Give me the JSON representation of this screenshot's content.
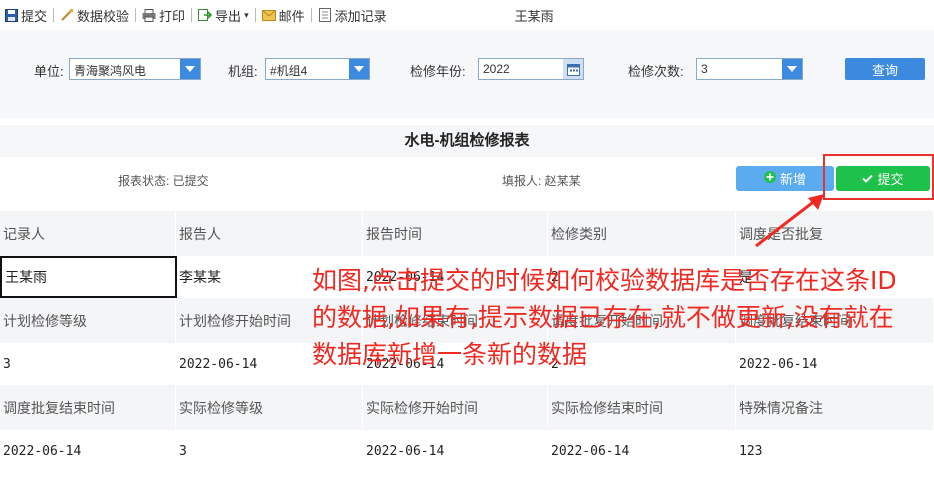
{
  "toolbar": {
    "items": [
      {
        "label": "提交",
        "icon": "save-icon"
      },
      {
        "label": "数据校验",
        "icon": "validate-icon"
      },
      {
        "label": "打印",
        "icon": "print-icon"
      },
      {
        "label": "导出",
        "icon": "export-icon"
      },
      {
        "label": "邮件",
        "icon": "mail-icon"
      },
      {
        "label": "添加记录",
        "icon": "add-record-icon"
      }
    ],
    "user": "王某雨"
  },
  "filter": {
    "unit_label": "单位:",
    "unit_value": "青海聚鸿风电",
    "unit_label_key": "unit",
    "machine_label": "机组:",
    "machine_value": "#机组4",
    "year_label": "检修年份:",
    "year_value": "2022",
    "count_label": "检修次数:",
    "count_value": "3",
    "query_label": "查询"
  },
  "report": {
    "title": "水电-机组检修报表",
    "status": "报表状态: 已提交",
    "filler": "填报人: 赵某某",
    "add_label": "新增",
    "submit_label": "提交"
  },
  "grid": {
    "row1_labels": [
      "记录人",
      "报告人",
      "报告时间",
      "检修类别",
      "调度是否批复"
    ],
    "row1_values": [
      "王某雨",
      "李某某",
      "2022-06-14",
      "2",
      "是"
    ],
    "row2_labels": [
      "计划检修等级",
      "计划检修开始时间",
      "计划检修结束时间",
      "调度批复开始时间",
      "调度批复结束时间"
    ],
    "row2_values": [
      "3",
      "2022-06-14",
      "2022-06-14",
      "2",
      "2022-06-14"
    ],
    "row3_labels": [
      "调度批复结束时间",
      "实际检修等级",
      "实际检修开始时间",
      "实际检修结束时间",
      "特殊情况备注"
    ],
    "row3_values": [
      "2022-06-14",
      "3",
      "2022-06-14",
      "2022-06-14",
      "123"
    ]
  },
  "annotation": {
    "text": "如图,点击提交的时候如何校验数据库是否存在这条ID的数据,如果有,提示数据已存在,就不做更新,没有就在数据库新增一条新的数据"
  },
  "colors": {
    "primary": "#3c8ae0",
    "submit": "#1ec14a",
    "annotation": "#f02a22"
  }
}
